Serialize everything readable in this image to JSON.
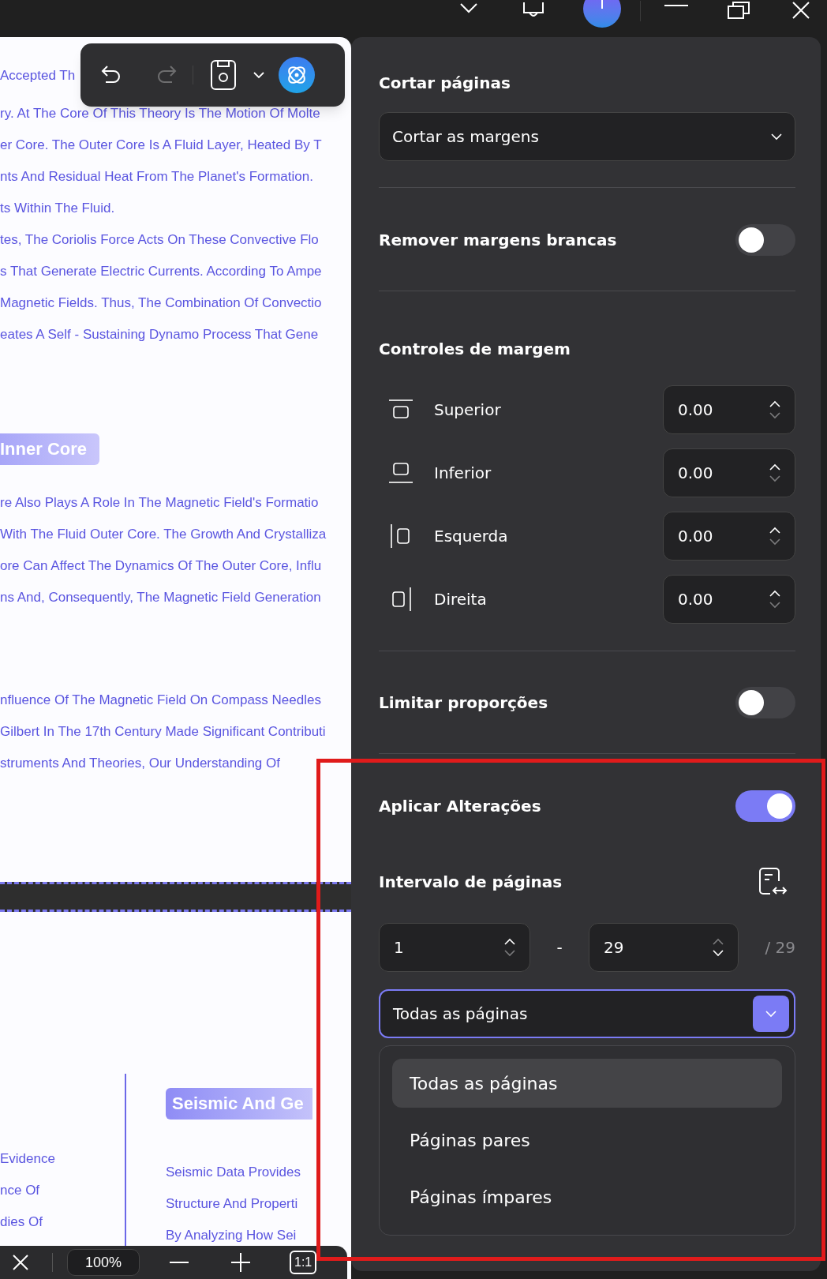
{
  "document": {
    "block_1": [
      "Accepted Th",
      "ry. At The Core Of This Theory Is The Motion Of Molte",
      "er Core. The Outer Core Is A Fluid Layer, Heated By T",
      "nts And Residual Heat From The Planet's Formation.",
      "ts Within The Fluid.",
      "tes, The Coriolis Force Acts On These Convective Flo",
      "s That Generate Electric Currents. According To Ampe",
      "Magnetic Fields. Thus, The Combination Of Convectio",
      "eates A Self - Sustaining Dynamo Process That Gene"
    ],
    "heading_1": "Inner Core",
    "block_2": [
      "re Also Plays A Role In The Magnetic Field's Formatio",
      "With The Fluid Outer Core. The Growth And Crystalliza",
      "ore Can Affect The Dynamics Of The Outer Core, Influ",
      "ns And, Consequently, The Magnetic Field Generation"
    ],
    "block_3": [
      "nfluence Of The Magnetic Field On Compass Needles",
      "Gilbert In The 17th Century Made Significant Contributi",
      "struments And Theories, Our Understanding Of"
    ],
    "left_column": [
      "Evidence",
      "nce Of",
      "dies Of"
    ],
    "heading_2": "Seismic And Ge",
    "right_column": [
      "Seismic Data Provides",
      "Structure And Properti",
      "By Analyzing How Sei"
    ]
  },
  "floating_toolbar": {
    "redo": {
      "disabled": true
    }
  },
  "zoom_bar": {
    "zoom": "100%",
    "actual_size": "1:1"
  },
  "panel": {
    "title": "Cortar páginas",
    "crop_mode": {
      "value": "Cortar as margens"
    },
    "remove_white_margins": {
      "label": "Remover margens brancas",
      "on": false
    },
    "margin_controls": {
      "title": "Controles de margem",
      "fields": [
        {
          "kind": "top",
          "label": "Superior",
          "value": "0.00"
        },
        {
          "kind": "bottom",
          "label": "Inferior",
          "value": "0.00"
        },
        {
          "kind": "left",
          "label": "Esquerda",
          "value": "0.00"
        },
        {
          "kind": "right",
          "label": "Direita",
          "value": "0.00"
        }
      ]
    },
    "limit_proportions": {
      "label": "Limitar proporções",
      "on": false
    },
    "apply_changes": {
      "label": "Aplicar Alterações",
      "on": true
    },
    "page_range": {
      "title": "Intervalo de páginas",
      "from": "1",
      "separator": "-",
      "to": "29",
      "total": "/ 29",
      "subset": {
        "value": "Todas as páginas",
        "expanded": true,
        "options": [
          {
            "label": "Todas as páginas",
            "selected": true
          },
          {
            "label": "Páginas pares",
            "selected": false
          },
          {
            "label": "Páginas ímpares",
            "selected": false
          }
        ]
      }
    }
  }
}
